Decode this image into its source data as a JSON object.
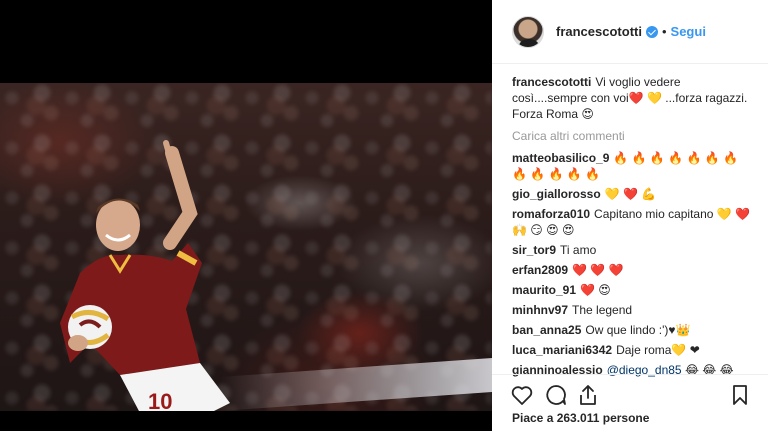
{
  "post": {
    "username": "francescototti",
    "follow_label": "Segui",
    "separator": "•",
    "caption": "Vi voglio vedere così....sempre con voi❤️ 💛 ...forza ragazzi. Forza Roma 😍",
    "load_more": "Carica altri commenti",
    "comments": [
      {
        "user": "matteobasilico_9",
        "text": "🔥 🔥 🔥 🔥 🔥 🔥 🔥 🔥 🔥 🔥 🔥 🔥"
      },
      {
        "user": "gio_giallorosso",
        "text": "💛 ❤️ 💪"
      },
      {
        "user": "romaforza010",
        "text": "Capitano mio capitano 💛 ❤️ 🙌 😏 😍 😍"
      },
      {
        "user": "sir_tor9",
        "text": "Ti amo"
      },
      {
        "user": "erfan2809",
        "text": "❤️ ❤️ ❤️"
      },
      {
        "user": "maurito_91",
        "text": "❤️ 😍"
      },
      {
        "user": "minhnv97",
        "text": "The legend"
      },
      {
        "user": "ban_anna25",
        "text": "Ow que lindo :')♥👑"
      },
      {
        "user": "luca_mariani6342",
        "text": "Daje roma💛 ❤"
      },
      {
        "user": "gianninoalessio",
        "mention": "@diego_dn85",
        "text": "😂 😂 😂"
      }
    ],
    "likes": "Piace a 263.011 persone"
  },
  "icons": {
    "avatar": "profile-photo",
    "verified": "verified-badge",
    "like": "heart-icon",
    "comment": "comment-bubble-icon",
    "share": "share-icon",
    "save": "bookmark-icon"
  },
  "colors": {
    "accent": "#3897f0",
    "text": "#262626",
    "muted": "#999999",
    "roma_red": "#8e1b1b",
    "roma_gold": "#f0bc42"
  }
}
